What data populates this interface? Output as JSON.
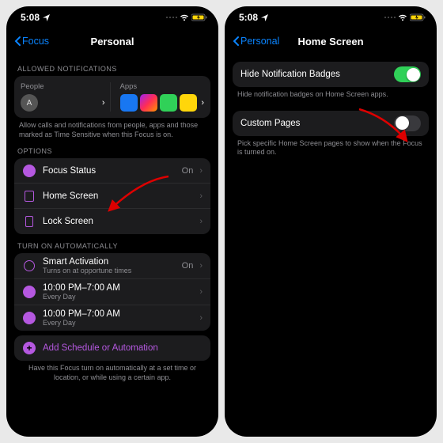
{
  "status": {
    "time": "5:08"
  },
  "left": {
    "back": "Focus",
    "title": "Personal",
    "allowed": {
      "header": "ALLOWED NOTIFICATIONS",
      "peopleLabel": "People",
      "appsLabel": "Apps",
      "personInitial": "A",
      "footer": "Allow calls and notifications from people, apps and those marked as Time Sensitive when this Focus is on."
    },
    "options": {
      "header": "OPTIONS",
      "items": [
        {
          "icon": "status",
          "label": "Focus Status",
          "value": "On"
        },
        {
          "icon": "home",
          "label": "Home Screen",
          "value": ""
        },
        {
          "icon": "lock",
          "label": "Lock Screen",
          "value": ""
        }
      ]
    },
    "auto": {
      "header": "TURN ON AUTOMATICALLY",
      "items": [
        {
          "icon": "smart",
          "label": "Smart Activation",
          "sub": "Turns on at opportune times",
          "value": "On"
        },
        {
          "icon": "time",
          "label": "10:00 PM–7:00 AM",
          "sub": "Every Day",
          "value": ""
        },
        {
          "icon": "time",
          "label": "10:00 PM–7:00 AM",
          "sub": "Every Day",
          "value": ""
        }
      ],
      "add": "Add Schedule or Automation",
      "footer": "Have this Focus turn on automatically at a set time or location, or while using a certain app."
    }
  },
  "right": {
    "back": "Personal",
    "title": "Home Screen",
    "row1": {
      "label": "Hide Notification Badges",
      "footer": "Hide notification badges on Home Screen apps."
    },
    "row2": {
      "label": "Custom Pages",
      "footer": "Pick specific Home Screen pages to show when the Focus is turned on."
    }
  },
  "colors": {
    "purple": "#b558e0",
    "green": "#30d158",
    "blue": "#0a84ff"
  }
}
